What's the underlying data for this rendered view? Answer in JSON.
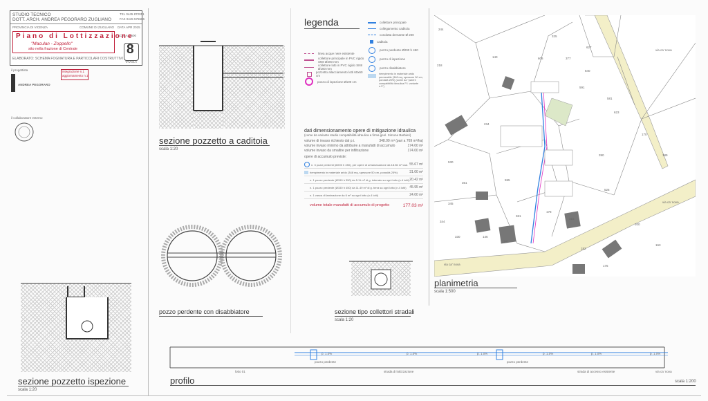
{
  "title_block": {
    "studio_line1": "STUDIO TECNICO",
    "studio_line2": "DOTT. ARCH. ANDREA PEGORARO ZUGLIANO",
    "tel": "TEL 0445 872051",
    "fax": "FAX 0445 575586",
    "province": "PROVINCIA DI VICENZA",
    "comune": "COMUNE DI ZUGLIANO",
    "data": "DATA APR 2015",
    "scala": "SCALA 1:500",
    "project_title": "Piano di Lottizzazione",
    "project_subtitle": "\"Maculan - Zoppello\"",
    "project_location": "sito nella frazione di Centrale",
    "sheet_number": "8",
    "sheet_label": "TAVOLA",
    "elaborato": "ELABORATO: SCHEMA FOGNATURA E PARTICOLARI COSTRUTTIVI",
    "progettista_label": "il progettista",
    "progettista_name": "ANDREA PEGORARO",
    "revision_1": "integrazione n.1",
    "revision_2": "aggiornamento n.1",
    "collaboratore_label": "il collaboratore esterno"
  },
  "legend": {
    "heading": "legenda",
    "left_items": [
      "linea acque nere esistente",
      "collettore principale in PVC rigido SN8 Ø200 mm",
      "collettore lotti in PVC rigido SN8 Ø160 mm",
      "pozzetto allacciamento lotti 60x60 cm",
      "pozzo di ispezione Ø100 cm"
    ],
    "right_items": [
      "collettore principale",
      "collegamento caditoia",
      "condotta drenante Ø 200",
      "caditoia",
      "pozzo perdente Ø200 h 450",
      "pozzo di ispezione",
      "pozzo disabbiatore",
      "riempimento in materiale arido permeabile (348 mq, spessore 50 cm, porosità 25%) (come da \"parere compatibilità idraulica P.I. variante n.3\")"
    ]
  },
  "dimensioning": {
    "title": "dati dimensionamento opere di mitigazione idraulica",
    "subtitle": "(come da variante studio compatibilità idraulica a firma geol. Simone Barbieri)",
    "lines": [
      {
        "label": "volume di invaso richiesto dal p.i.",
        "value": "348.00 m³ (pari a 769 m³/ha)"
      },
      {
        "label": "volume invaso minimo da attribuire a manufatti di accumulo",
        "value": "174.00 m³"
      },
      {
        "label": "volume invaso da smaltire per infiltrazione",
        "value": "174.00 m³"
      }
    ],
    "planned_title": "opere di accumulo previste:",
    "planned": [
      {
        "label": "n. 3 pozzi perdenti (Ø200 h 450), per opere di urbanizzazione da 18.56 m³ cad.",
        "value": "55.67 m³"
      },
      {
        "label": "riempimento in materiale arido (348 mq, spessore 50 cm, porosità 25%)",
        "value": "31.00 m³"
      },
      {
        "label": "n. 1 pozzo perdente (Ø150 h 350) da 5.11 m³ di g. interrato su ogni lotto (n.4 lotti)",
        "value": "20.42 m³"
      },
      {
        "label": "n. 1 pozzo perdente (Ø150 h 450) da 11.49 m³ di g. terra su ogni lotto (n.4 lotti)",
        "value": "45.95 m³"
      },
      {
        "label": "n. 1 vasca di laminazione da 6 m³ su ogni lotto (n.4 lotti)",
        "value": "24.00 m³"
      }
    ],
    "total_label": "volume totale manufatti di accumulo di progetto",
    "total_value": "177.03 m³"
  },
  "drawings": {
    "caditoia_title": "sezione pozzetto a caditoia",
    "caditoia_scale": "scala 1:20",
    "perdente_title": "pozzo perdente con disabbiatore",
    "collettori_title": "sezione tipo collettori stradali",
    "collettori_scale": "scala 1:20",
    "ispezione_title": "sezione pozzetto ispezione",
    "ispezione_scale": "scala 1:20",
    "planimetria_title": "planimetria",
    "planimetria_scale": "scala 1:500",
    "profilo_title": "profilo",
    "profilo_scale": "scala 1:200"
  },
  "profile": {
    "slopes": [
      "p. 1.0%",
      "p. 1.0%",
      "p. 1.0%",
      "p. 1.0%",
      "p. 1.0%",
      "p. 1.0%"
    ],
    "pozzo_labels": [
      "pozzo perdente",
      "pozzo perdente"
    ],
    "segments": [
      "lotto 01",
      "strada di lottizzazione",
      "strada di accesso esistente",
      "via ca' nova"
    ]
  },
  "map": {
    "street_labels": [
      "via ca' nova",
      "via ca' nova",
      "via ca' nova"
    ],
    "parcel_numbers": [
      "244",
      "325",
      "377",
      "627",
      "218",
      "140",
      "840",
      "591",
      "581",
      "623",
      "234",
      "530",
      "351",
      "555",
      "345",
      "361",
      "146",
      "178",
      "315",
      "182",
      "526",
      "344",
      "330",
      "181",
      "170",
      "189",
      "606",
      "200",
      "175",
      "163",
      "390"
    ]
  }
}
